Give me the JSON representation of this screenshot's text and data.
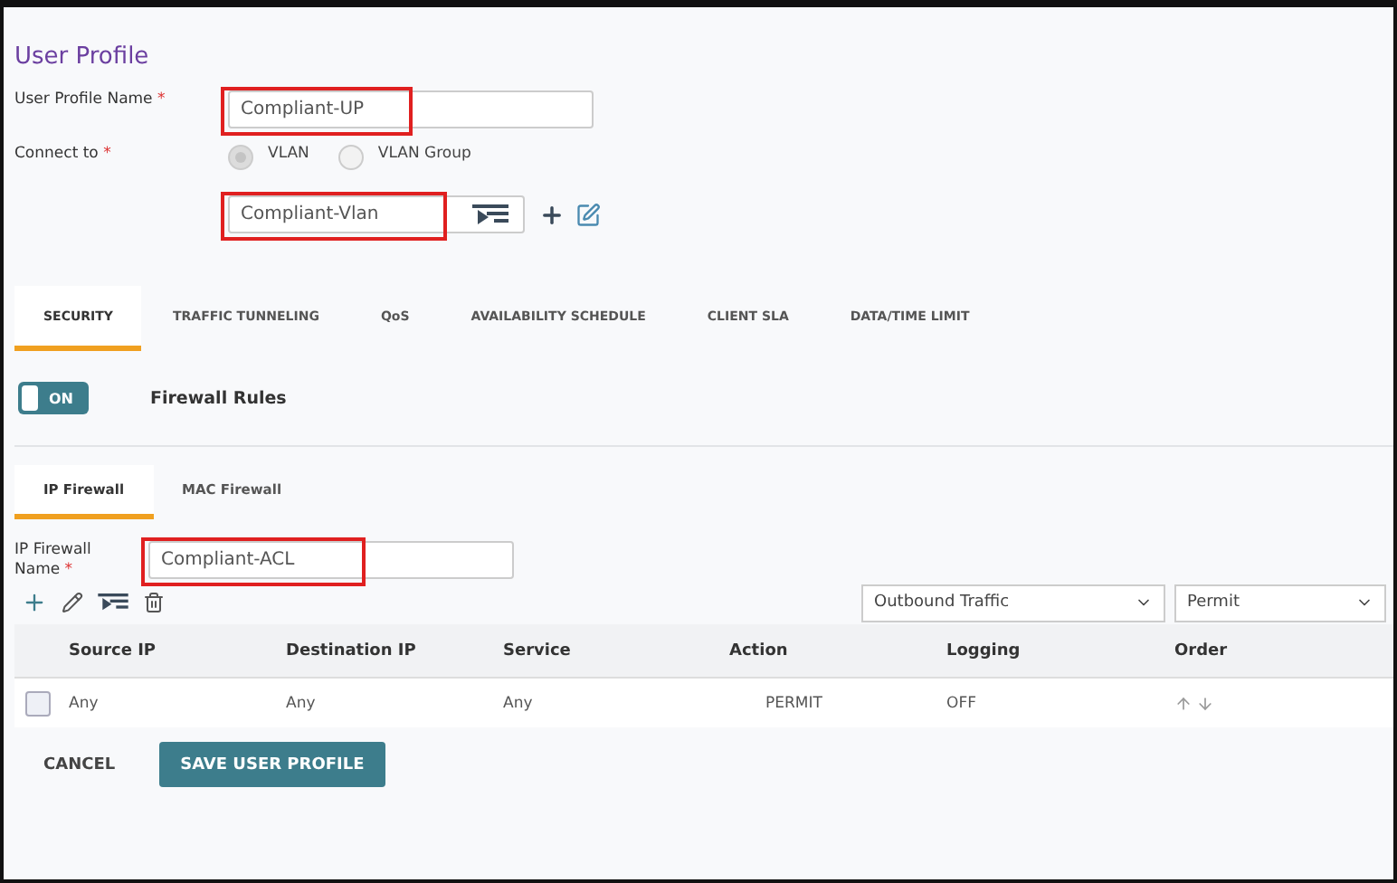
{
  "title": "User Profile",
  "profile_name": {
    "label": "User Profile Name",
    "required_mark": "*",
    "value": "Compliant-UP",
    "highlighted": true
  },
  "connect_to": {
    "label": "Connect to",
    "required_mark": "*",
    "options": [
      {
        "label": "VLAN",
        "selected": true
      },
      {
        "label": "VLAN Group",
        "selected": false
      }
    ],
    "value": "Compliant-Vlan",
    "highlighted": true
  },
  "tabs": [
    {
      "label": "SECURITY",
      "selected": true
    },
    {
      "label": "TRAFFIC TUNNELING",
      "selected": false
    },
    {
      "label": "QoS",
      "selected": false
    },
    {
      "label": "AVAILABILITY SCHEDULE",
      "selected": false
    },
    {
      "label": "CLIENT SLA",
      "selected": false
    },
    {
      "label": "DATA/TIME LIMIT",
      "selected": false
    }
  ],
  "firewall_toggle": {
    "label": "ON",
    "on": true,
    "title": "Firewall Rules"
  },
  "sub_tabs": [
    {
      "label": "IP Firewall",
      "selected": true
    },
    {
      "label": "MAC Firewall",
      "selected": false
    }
  ],
  "ip_firewall_name": {
    "label": "IP Firewall Name",
    "required_mark": "*",
    "value": "Compliant-ACL",
    "highlighted": true
  },
  "direction_select": {
    "value": "Outbound Traffic"
  },
  "action_select": {
    "value": "Permit"
  },
  "table": {
    "columns": [
      "Source IP",
      "Destination IP",
      "Service",
      "Action",
      "Logging",
      "Order"
    ],
    "rows": [
      {
        "checked": false,
        "cells": [
          "Any",
          "Any",
          "Any",
          "PERMIT",
          "OFF"
        ]
      }
    ]
  },
  "buttons": {
    "cancel": "CANCEL",
    "save": "SAVE USER PROFILE"
  }
}
